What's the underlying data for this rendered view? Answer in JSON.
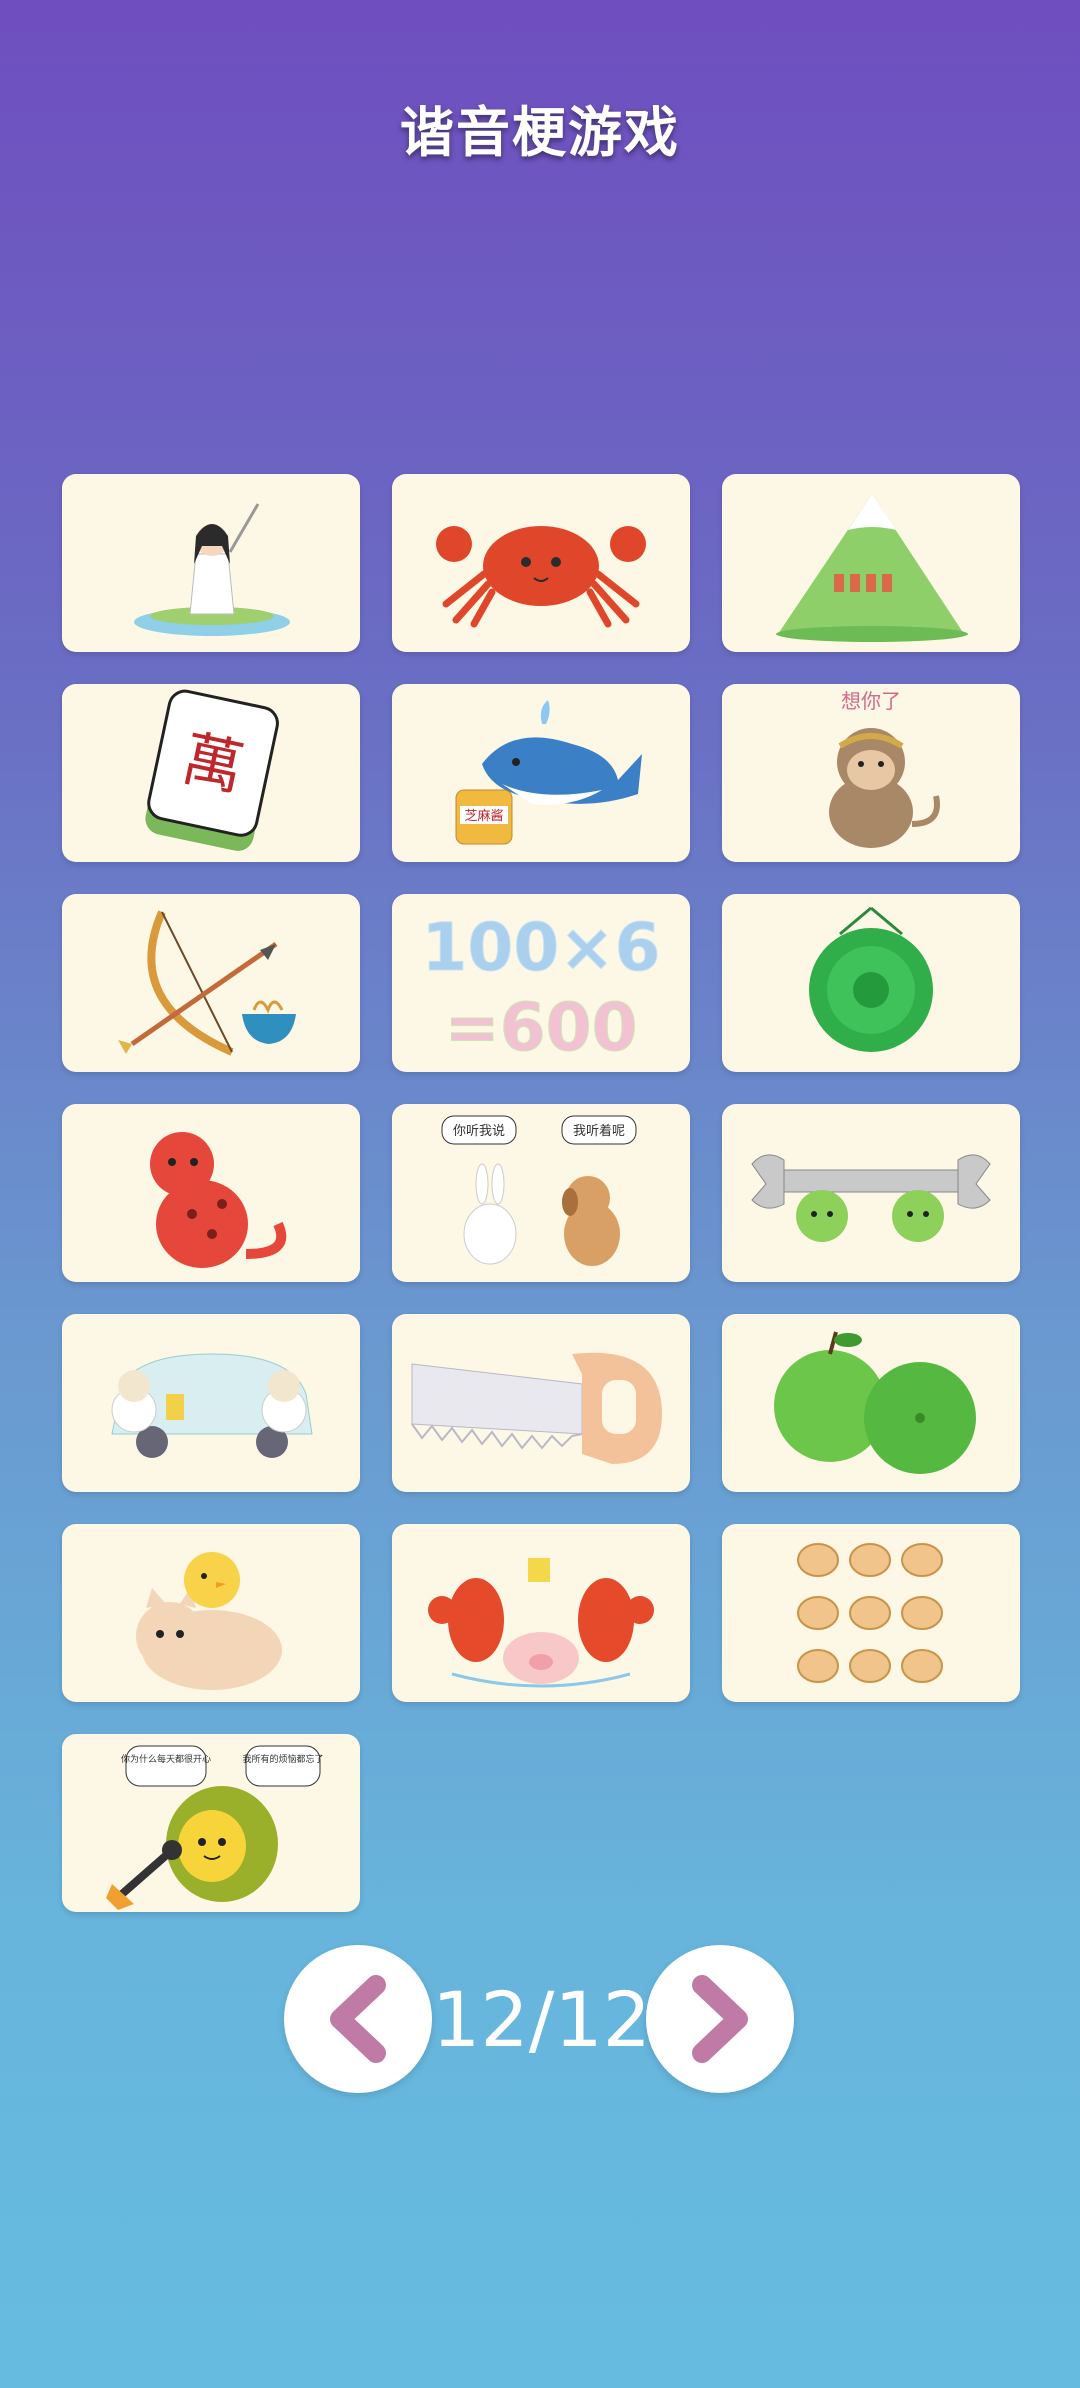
{
  "app": {
    "title": "谐音梗游戏"
  },
  "cards": [
    {
      "icon": "swordsman-by-lake-icon"
    },
    {
      "icon": "crab-icon"
    },
    {
      "icon": "mountain-with-people-icon"
    },
    {
      "icon": "mahjong-tile-icon",
      "text": "萬"
    },
    {
      "icon": "whale-with-sesame-jar-icon",
      "text": "芝麻酱"
    },
    {
      "icon": "monkey-missing-you-icon",
      "text": "想你了"
    },
    {
      "icon": "bow-arrow-noodle-icon"
    },
    {
      "icon": "math-equation-icon",
      "line1": "100×6",
      "line2": "=600"
    },
    {
      "icon": "green-gong-icon"
    },
    {
      "icon": "leopard-icon"
    },
    {
      "icon": "rabbit-and-dog-icon",
      "bubble1": "你听我说",
      "bubble2": "我听着呢"
    },
    {
      "icon": "wrench-with-moss-balls-icon"
    },
    {
      "icon": "sheep-washing-car-icon"
    },
    {
      "icon": "saw-icon"
    },
    {
      "icon": "green-apple-and-lime-icon"
    },
    {
      "icon": "chick-on-cat-icon"
    },
    {
      "icon": "lobsters-with-pig-icon"
    },
    {
      "icon": "ginger-pieces-icon"
    },
    {
      "icon": "interviewed-durian-icon",
      "bubble1": "你为什么每天都很开心",
      "bubble2": "我所有的烦恼都忘了"
    }
  ],
  "pager": {
    "current": "12/12",
    "prev": "chevron-left-icon",
    "next": "chevron-right-icon"
  },
  "colors": {
    "accent": "#c07aa6",
    "card": "#fdf8e6"
  }
}
